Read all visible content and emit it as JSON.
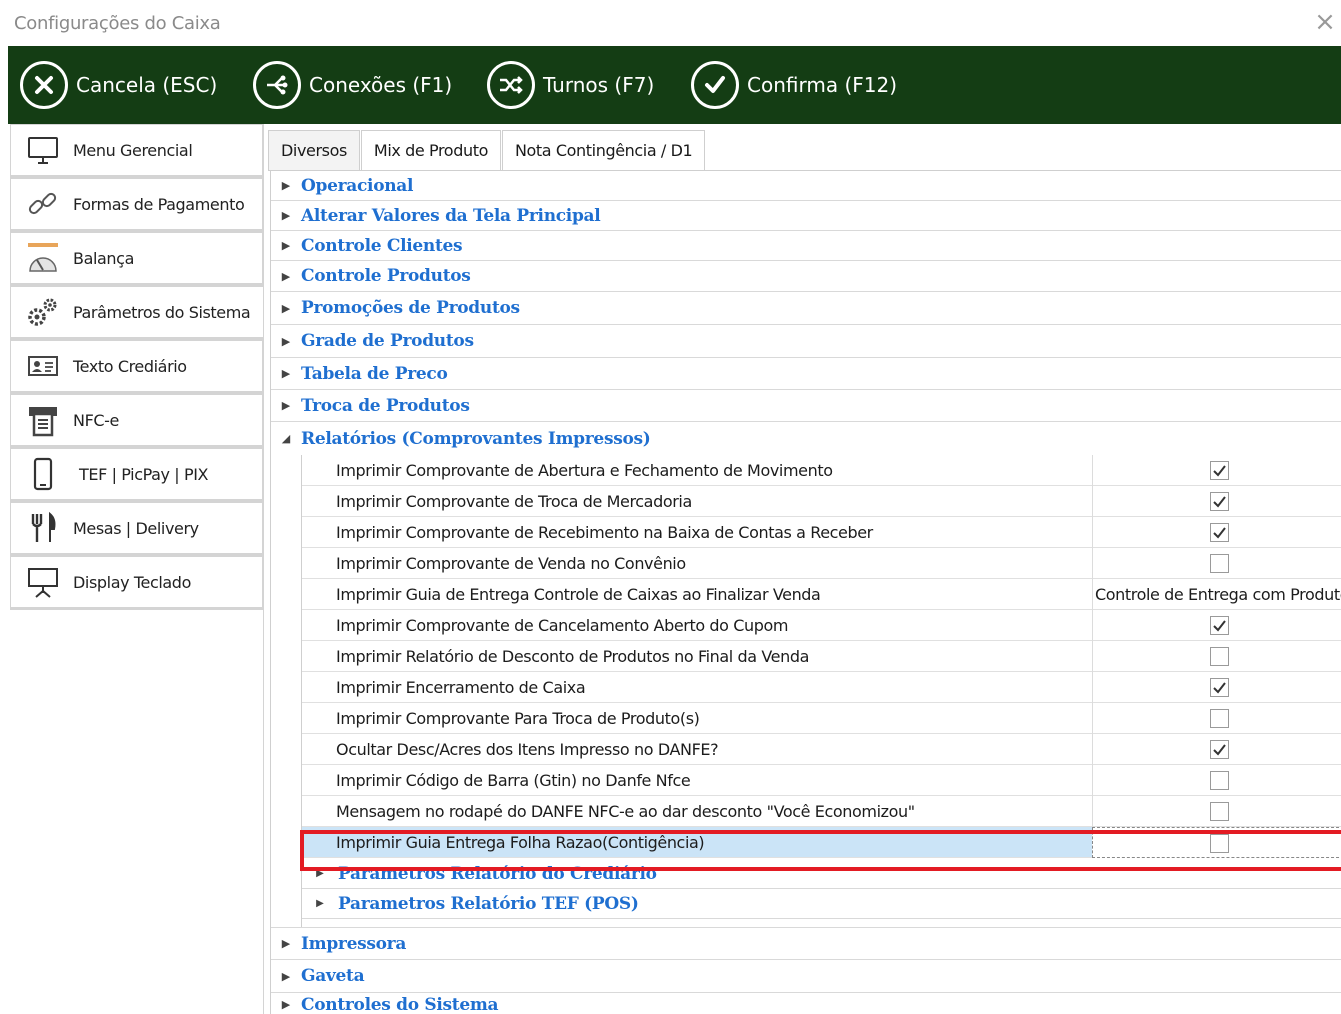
{
  "window": {
    "title": "Configurações do Caixa",
    "close_symbol": "×"
  },
  "toolbar": {
    "color": "#143d14",
    "buttons": [
      {
        "label": "Cancela (ESC)",
        "icon": "cancel-circle-icon"
      },
      {
        "label": "Conexões (F1)",
        "icon": "connections-icon"
      },
      {
        "label": "Turnos (F7)",
        "icon": "shuffle-icon"
      },
      {
        "label": "Confirma (F12)",
        "icon": "check-circle-icon"
      }
    ]
  },
  "sidebar": {
    "items": [
      {
        "label": "Menu Gerencial",
        "icon": "monitor-icon"
      },
      {
        "label": "Formas de Pagamento",
        "icon": "link-icon"
      },
      {
        "label": "Balança",
        "icon": "scale-icon"
      },
      {
        "label": "Parâmetros do Sistema",
        "icon": "gears-icon"
      },
      {
        "label": "Texto Crediário",
        "icon": "id-card-icon"
      },
      {
        "label": "NFC-e",
        "icon": "receipt-printer-icon"
      },
      {
        "label": "TEF | PicPay | PIX",
        "icon": "smartphone-icon"
      },
      {
        "label": "Mesas | Delivery",
        "icon": "cutlery-icon"
      },
      {
        "label": "Display Teclado",
        "icon": "display-stand-icon"
      }
    ],
    "active_index": 3
  },
  "tabs": [
    {
      "label": "Diversos",
      "active": true
    },
    {
      "label": "Mix de Produto",
      "active": false
    },
    {
      "label": "Nota Contingência / D1",
      "active": false
    }
  ],
  "groups_top": [
    "Operacional",
    "Alterar Valores da Tela Principal",
    "Controle Clientes",
    "Controle Produtos",
    "Promoções de Produtos",
    "Grade de Produtos",
    "Tabela de Preco",
    "Troca de Produtos"
  ],
  "expanded_group": {
    "label": "Relatórios (Comprovantes Impressos)",
    "rows": [
      {
        "label": "Imprimir Comprovante de Abertura e Fechamento de  Movimento",
        "type": "check",
        "checked": true
      },
      {
        "label": "Imprimir Comprovante de Troca de Mercadoria",
        "type": "check",
        "checked": true
      },
      {
        "label": "Imprimir Comprovante de Recebimento na Baixa de Contas a Receber",
        "type": "check",
        "checked": true
      },
      {
        "label": "Imprimir Comprovante de Venda no Convênio",
        "type": "check",
        "checked": false
      },
      {
        "label": "Imprimir Guia de Entrega Controle de Caixas ao Finalizar Venda",
        "type": "text",
        "value": "Controle de Entrega com Produto"
      },
      {
        "label": "Imprimir Comprovante de Cancelamento Aberto do Cupom",
        "type": "check",
        "checked": true
      },
      {
        "label": "Imprimir Relatório de Desconto de Produtos no Final da Venda",
        "type": "check",
        "checked": false
      },
      {
        "label": "Imprimir Encerramento de Caixa",
        "type": "check",
        "checked": true
      },
      {
        "label": "Imprimir Comprovante Para Troca de Produto(s)",
        "type": "check",
        "checked": false
      },
      {
        "label": "Ocultar Desc/Acres dos Itens Impresso no DANFE?",
        "type": "check",
        "checked": true
      },
      {
        "label": "Imprimir Código de Barra (Gtin) no Danfe Nfce",
        "type": "check",
        "checked": false
      },
      {
        "label": "Mensagem no rodapé do DANFE NFC-e ao dar desconto \"Você Economizou\"",
        "type": "check",
        "checked": false
      },
      {
        "label": "Imprimir Guia Entrega Folha Razao(Contigência)",
        "type": "check",
        "checked": false,
        "selected": true
      }
    ],
    "subgroups": [
      "Parametros Relatório do Crediário",
      "Parametros Relatório TEF (POS)"
    ]
  },
  "groups_bottom": [
    "Impressora",
    "Gaveta",
    "Controles do Sistema"
  ],
  "colors": {
    "group_label": "#1f6fd0",
    "highlight_border": "#e31b23",
    "selected_row": "#cbe4f7"
  }
}
